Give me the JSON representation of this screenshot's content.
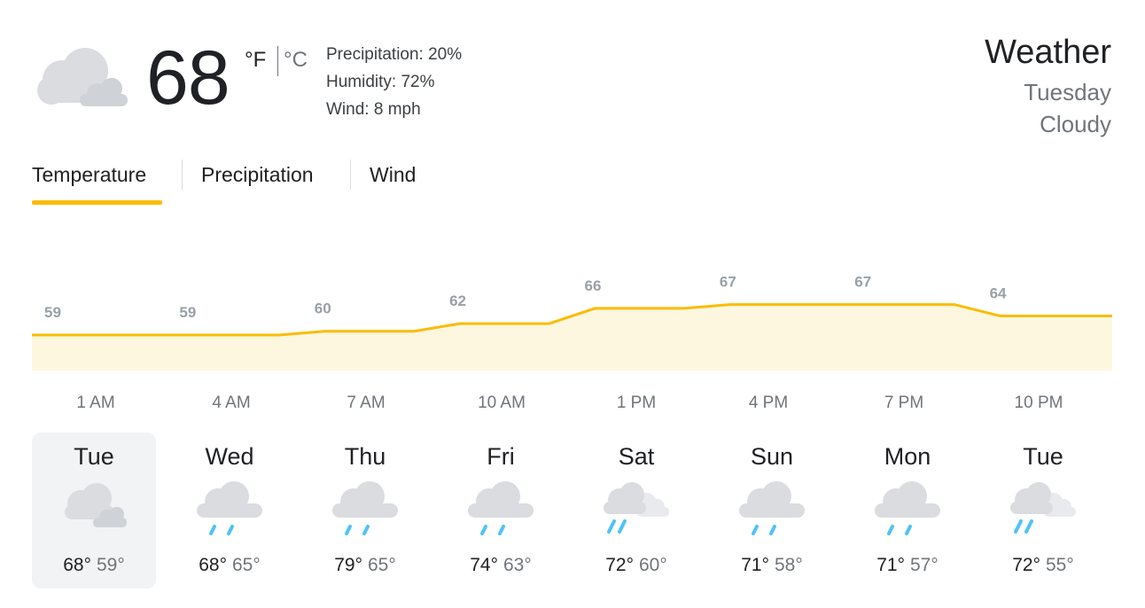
{
  "current": {
    "temperature": "68",
    "unit_f": "°F",
    "unit_c": "°C",
    "precipitation": "Precipitation: 20%",
    "humidity": "Humidity: 72%",
    "wind": "Wind: 8 mph",
    "icon": "cloudy-icon"
  },
  "header": {
    "title": "Weather",
    "day": "Tuesday",
    "condition": "Cloudy"
  },
  "tabs": [
    {
      "label": "Temperature",
      "active": true
    },
    {
      "label": "Precipitation",
      "active": false
    },
    {
      "label": "Wind",
      "active": false
    }
  ],
  "colors": {
    "accent": "#fbbc04",
    "fill": "#fef7e0",
    "label": "#9aa0a6"
  },
  "chart_data": {
    "type": "area",
    "x": [
      "1 AM",
      "4 AM",
      "7 AM",
      "10 AM",
      "1 PM",
      "4 PM",
      "7 PM",
      "10 PM"
    ],
    "values": [
      59,
      59,
      60,
      62,
      66,
      67,
      67,
      64
    ],
    "series": [
      {
        "values": [
          59,
          59,
          60,
          62,
          66,
          67,
          67,
          64
        ]
      }
    ]
  },
  "hours": [
    "1 AM",
    "4 AM",
    "7 AM",
    "10 AM",
    "1 PM",
    "4 PM",
    "7 PM",
    "10 PM"
  ],
  "forecast": [
    {
      "day": "Tue",
      "high": "68°",
      "low": "59°",
      "icon": "cloudy-icon",
      "selected": true
    },
    {
      "day": "Wed",
      "high": "68°",
      "low": "65°",
      "icon": "rain-icon",
      "selected": false
    },
    {
      "day": "Thu",
      "high": "79°",
      "low": "65°",
      "icon": "rain-icon",
      "selected": false
    },
    {
      "day": "Fri",
      "high": "74°",
      "low": "63°",
      "icon": "rain-icon",
      "selected": false
    },
    {
      "day": "Sat",
      "high": "72°",
      "low": "60°",
      "icon": "showers-icon",
      "selected": false
    },
    {
      "day": "Sun",
      "high": "71°",
      "low": "58°",
      "icon": "rain-icon",
      "selected": false
    },
    {
      "day": "Mon",
      "high": "71°",
      "low": "57°",
      "icon": "rain-icon",
      "selected": false
    },
    {
      "day": "Tue",
      "high": "72°",
      "low": "55°",
      "icon": "showers-icon",
      "selected": false
    }
  ]
}
